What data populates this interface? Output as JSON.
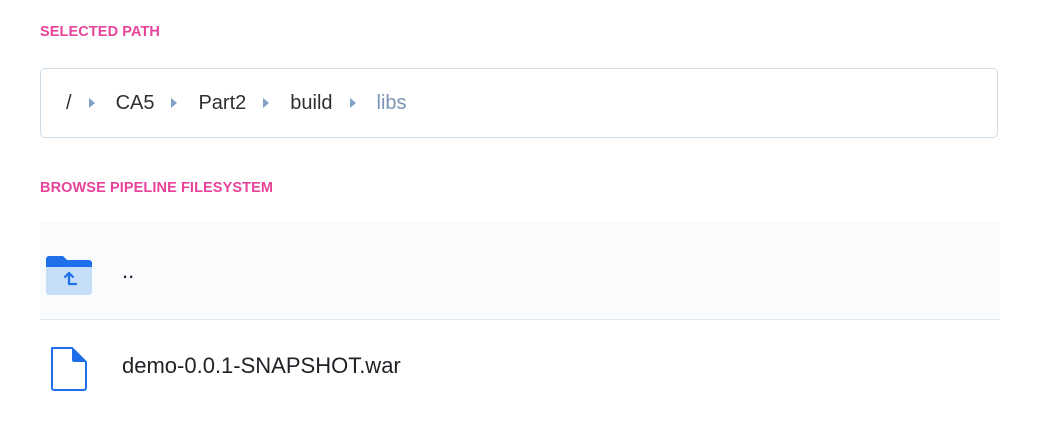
{
  "sections": {
    "selected_path_label": "SELECTED PATH",
    "browse_label": "BROWSE PIPELINE FILESYSTEM"
  },
  "breadcrumb": {
    "root": "/",
    "items": [
      "CA5",
      "Part2",
      "build"
    ],
    "current": "libs"
  },
  "files": {
    "parent": {
      "name": "..",
      "icon": "folder-up-icon"
    },
    "items": [
      {
        "name": "demo-0.0.1-SNAPSHOT.war",
        "icon": "file-icon"
      }
    ]
  },
  "colors": {
    "section_label": "#e7439a",
    "breadcrumb_current": "#7b94b5",
    "breadcrumb_separator": "#7fa2c6",
    "icon_blue": "#1f6feb",
    "icon_light_blue": "#c6def9"
  }
}
